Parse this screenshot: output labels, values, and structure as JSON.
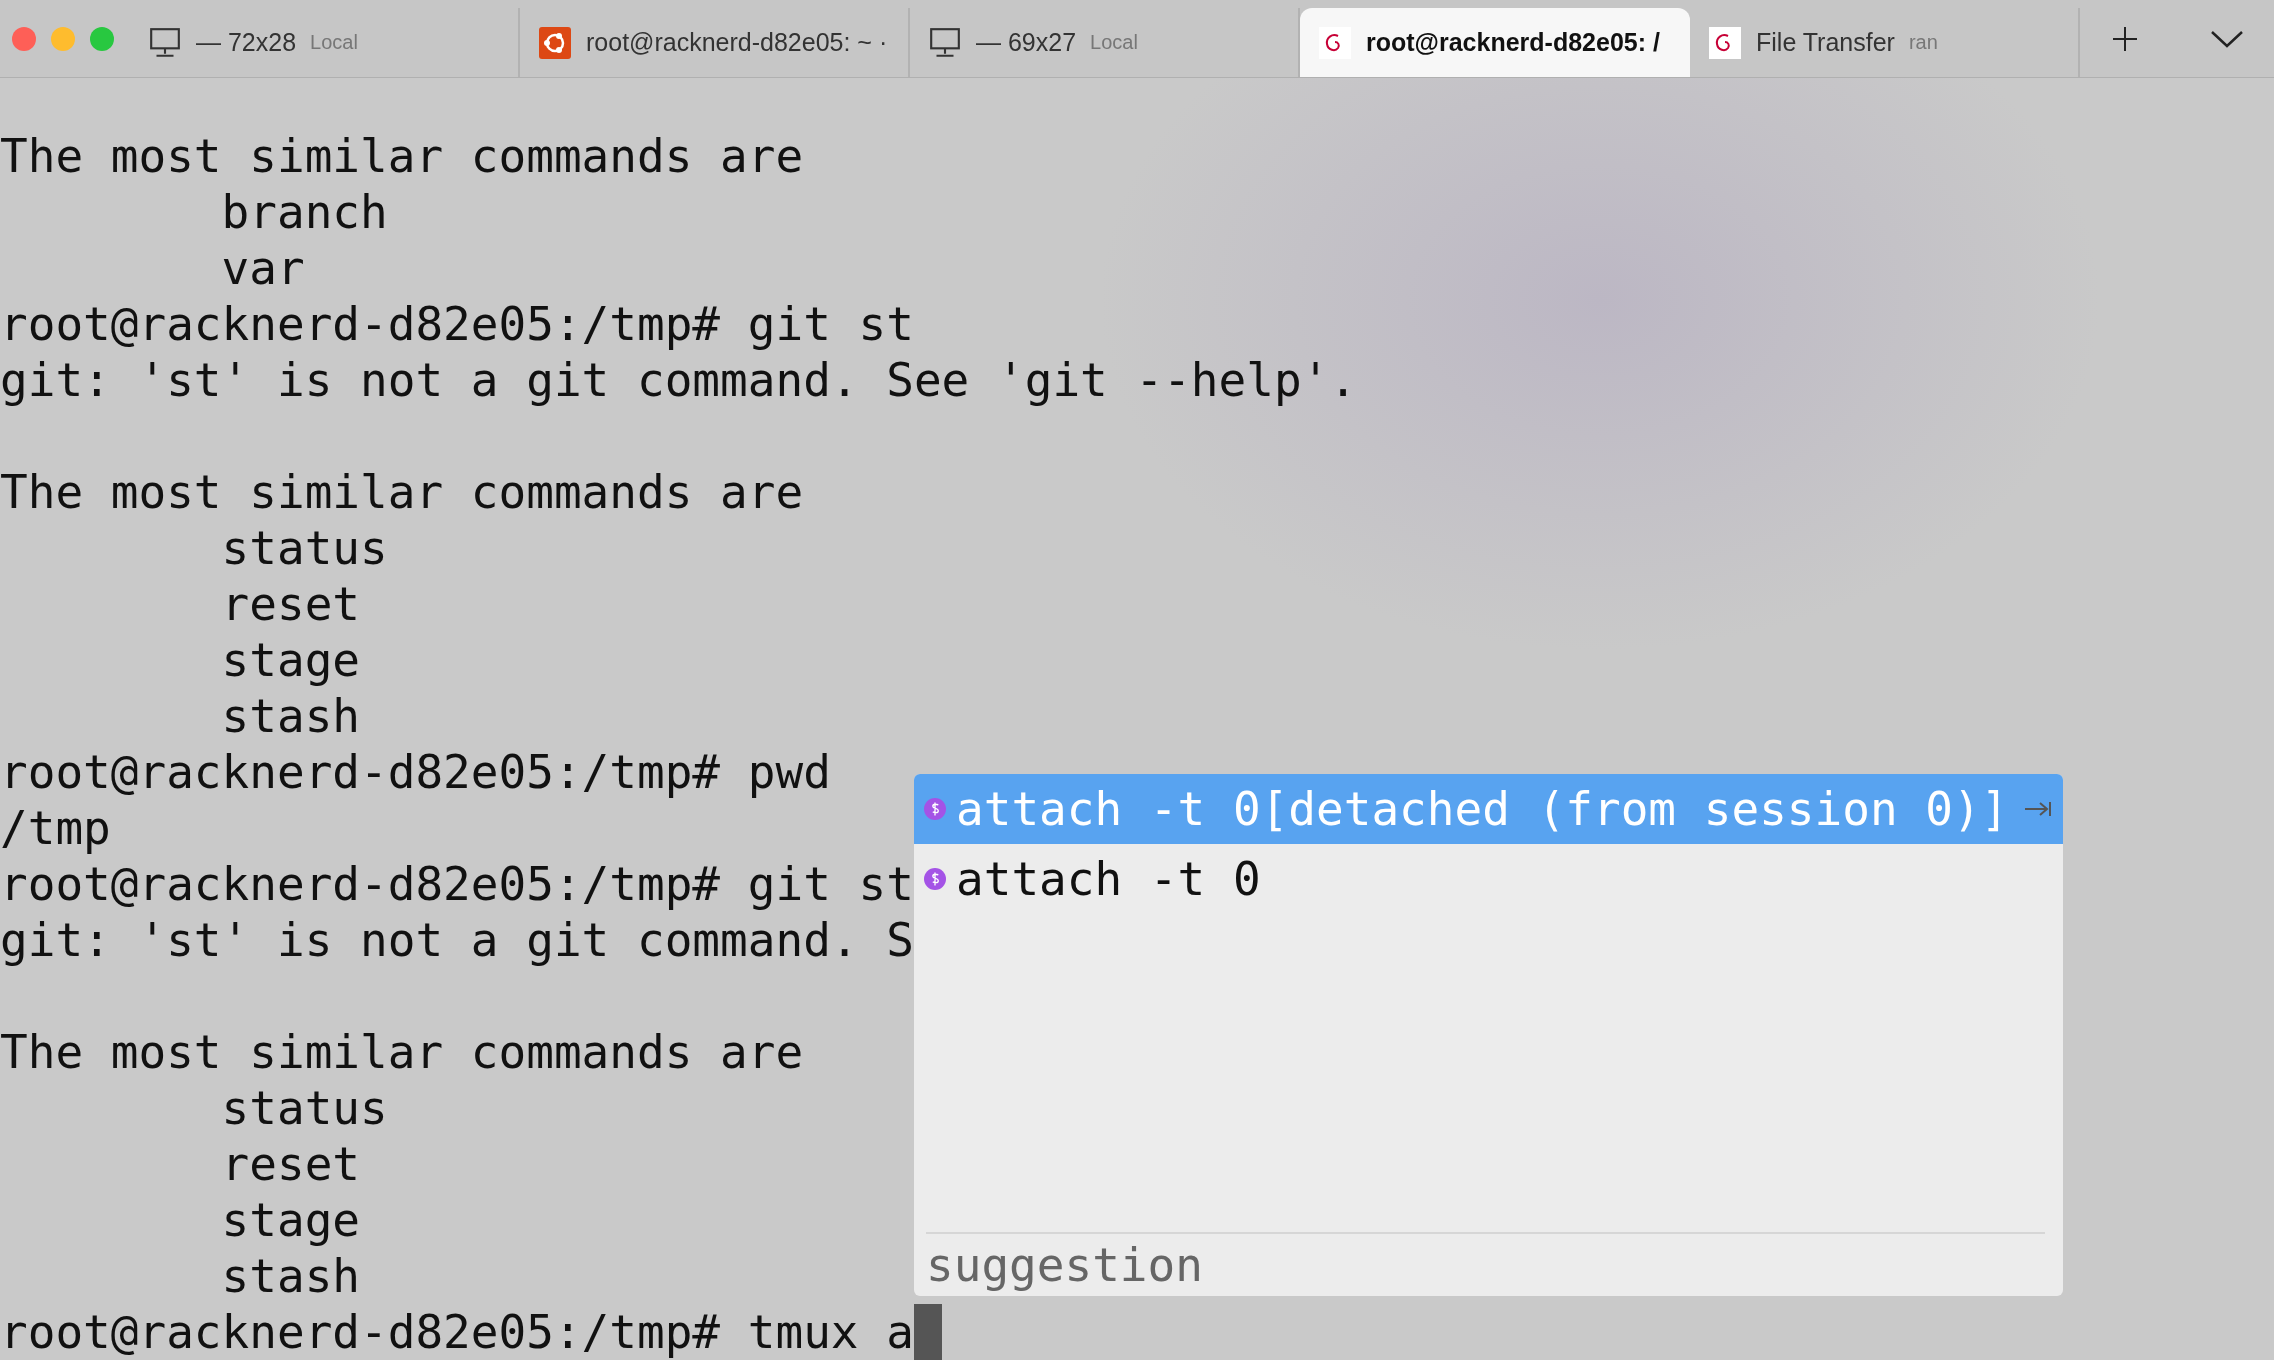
{
  "tabs": [
    {
      "kind": "local",
      "title": "— 72x28",
      "subtitle": "Local",
      "selected": false
    },
    {
      "kind": "ubuntu",
      "title": "root@racknerd-d82e05: ~ ·",
      "selected": false
    },
    {
      "kind": "local",
      "title": "— 69x27",
      "subtitle": "Local",
      "selected": false
    },
    {
      "kind": "debian",
      "title": "root@racknerd-d82e05: /",
      "selected": true
    },
    {
      "kind": "debian",
      "title": "File Transfer",
      "subtitle": "ran",
      "selected": false
    }
  ],
  "terminal": {
    "blocks": [
      [
        "The most similar commands are",
        "        branch",
        "        var",
        "root@racknerd-d82e05:/tmp# git st",
        "git: 'st' is not a git command. See 'git --help'."
      ],
      [
        "The most similar commands are",
        "        status",
        "        reset",
        "        stage",
        "        stash",
        "root@racknerd-d82e05:/tmp# pwd",
        "/tmp",
        "root@racknerd-d82e05:/tmp# git st",
        "git: 'st' is not a git command. S"
      ],
      [
        "The most similar commands are",
        "        status",
        "        reset",
        "        stage",
        "        stash"
      ]
    ],
    "prompt": "root@racknerd-d82e05:/tmp# tmux a"
  },
  "autocomplete": {
    "items": [
      {
        "text": "attach -t 0[detached (from session 0)]",
        "selected": true
      },
      {
        "text": "attach -t 0",
        "selected": false
      }
    ],
    "footer": "suggestion"
  }
}
